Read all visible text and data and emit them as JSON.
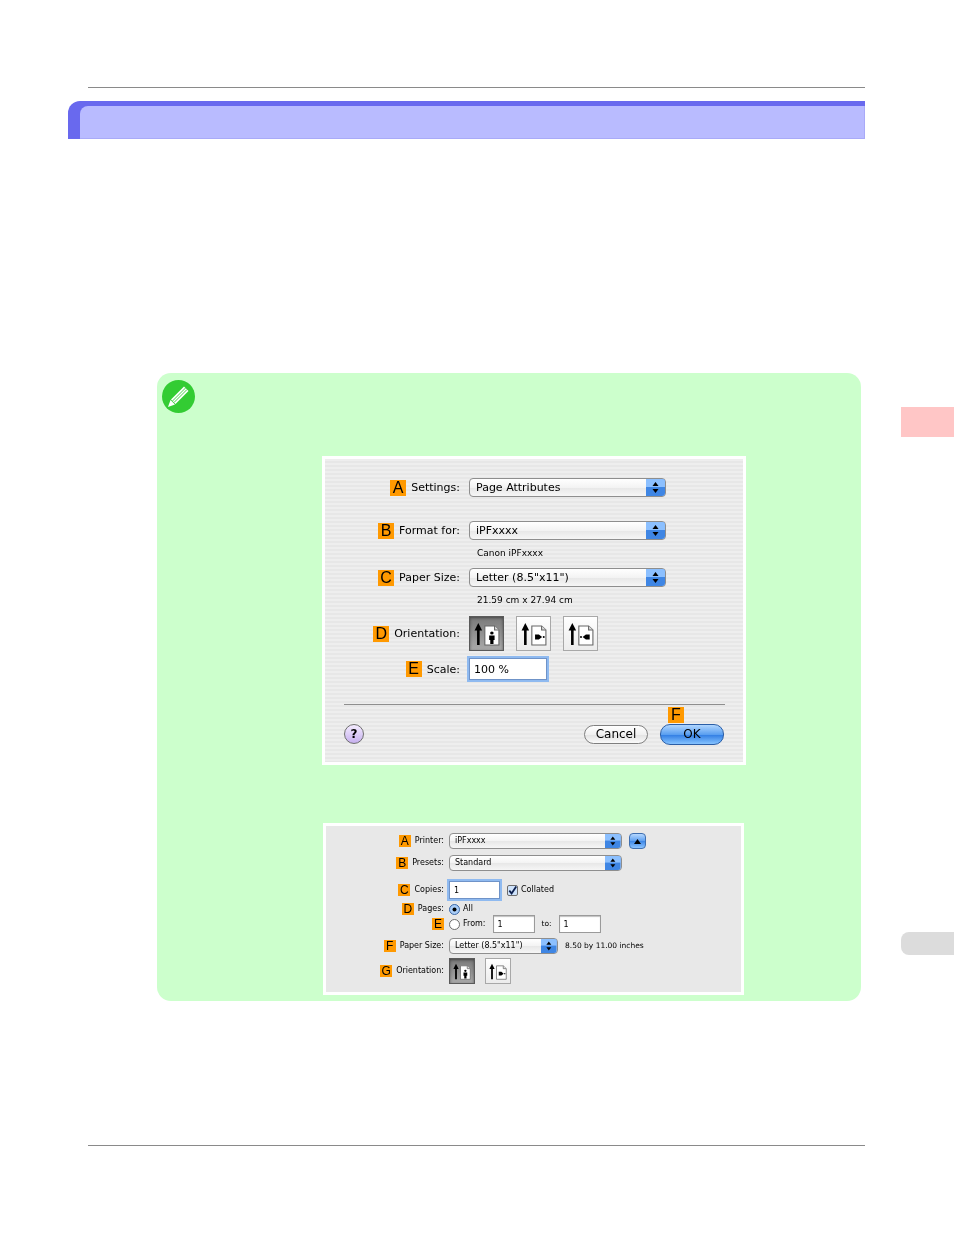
{
  "side_tabs": [
    {
      "selected": true
    },
    {
      "selected": false
    }
  ],
  "note": {
    "page_setup_dialog": {
      "rows": [
        {
          "marker": "A",
          "label": "Settings:",
          "controls": [
            {
              "kind": "popup",
              "value": "Page Attributes"
            }
          ]
        },
        {
          "marker": "B",
          "label": "Format for:",
          "controls": [
            {
              "kind": "popup",
              "value": "iPFxxxx"
            }
          ],
          "note": "Canon iPFxxxx"
        },
        {
          "marker": "C",
          "label": "Paper Size:",
          "controls": [
            {
              "kind": "popup",
              "value": "Letter (8.5\"x11\")"
            }
          ],
          "note": "21.59 cm x 27.94 cm"
        },
        {
          "marker": "D",
          "label": "Orientation:",
          "controls": [
            {
              "kind": "portrait_button",
              "selected": true
            },
            {
              "kind": "landscape_button",
              "selected": false
            },
            {
              "kind": "reverse_landscape_button",
              "selected": false
            }
          ]
        },
        {
          "marker": "E",
          "label": "Scale:",
          "controls": [
            {
              "kind": "field",
              "value": "100 %",
              "focused": true
            }
          ]
        }
      ],
      "help_button": "?",
      "buttons": [
        {
          "label": "Cancel",
          "default": false
        },
        {
          "label": "OK",
          "default": true,
          "marker": "F"
        }
      ]
    },
    "print_dialog": {
      "rows": [
        {
          "marker": "A",
          "label": "Printer:",
          "controls": [
            {
              "kind": "popup",
              "value": "iPFxxxx"
            },
            {
              "kind": "disclosure_button"
            }
          ]
        },
        {
          "marker": "B",
          "label": "Presets:",
          "controls": [
            {
              "kind": "popup",
              "value": "Standard"
            }
          ]
        },
        {
          "marker": "C",
          "label": "Copies:",
          "controls": [
            {
              "kind": "field",
              "value": "1",
              "focused": true
            },
            {
              "kind": "checkbox",
              "label": "Collated",
              "checked": true
            }
          ]
        },
        {
          "marker": "D",
          "label": "Pages:",
          "controls": [
            {
              "kind": "radio",
              "label": "All",
              "selected": true
            }
          ]
        },
        {
          "marker": "E",
          "controls": [
            {
              "kind": "radio",
              "label": "From:",
              "selected": false
            },
            {
              "kind": "field",
              "value": "1",
              "focused": false
            },
            {
              "kind": "text",
              "text": "to:"
            },
            {
              "kind": "field",
              "value": "1",
              "focused": false
            }
          ]
        },
        {
          "marker": "F",
          "label": "Paper Size:",
          "controls": [
            {
              "kind": "popup",
              "value": "Letter (8.5\"x11\")"
            },
            {
              "kind": "text",
              "text": "8.50 by 11.00 inches"
            }
          ]
        },
        {
          "marker": "G",
          "label": "Orientation:",
          "controls": [
            {
              "kind": "portrait_button",
              "selected": true
            },
            {
              "kind": "landscape_button",
              "selected": false
            }
          ]
        }
      ]
    }
  }
}
